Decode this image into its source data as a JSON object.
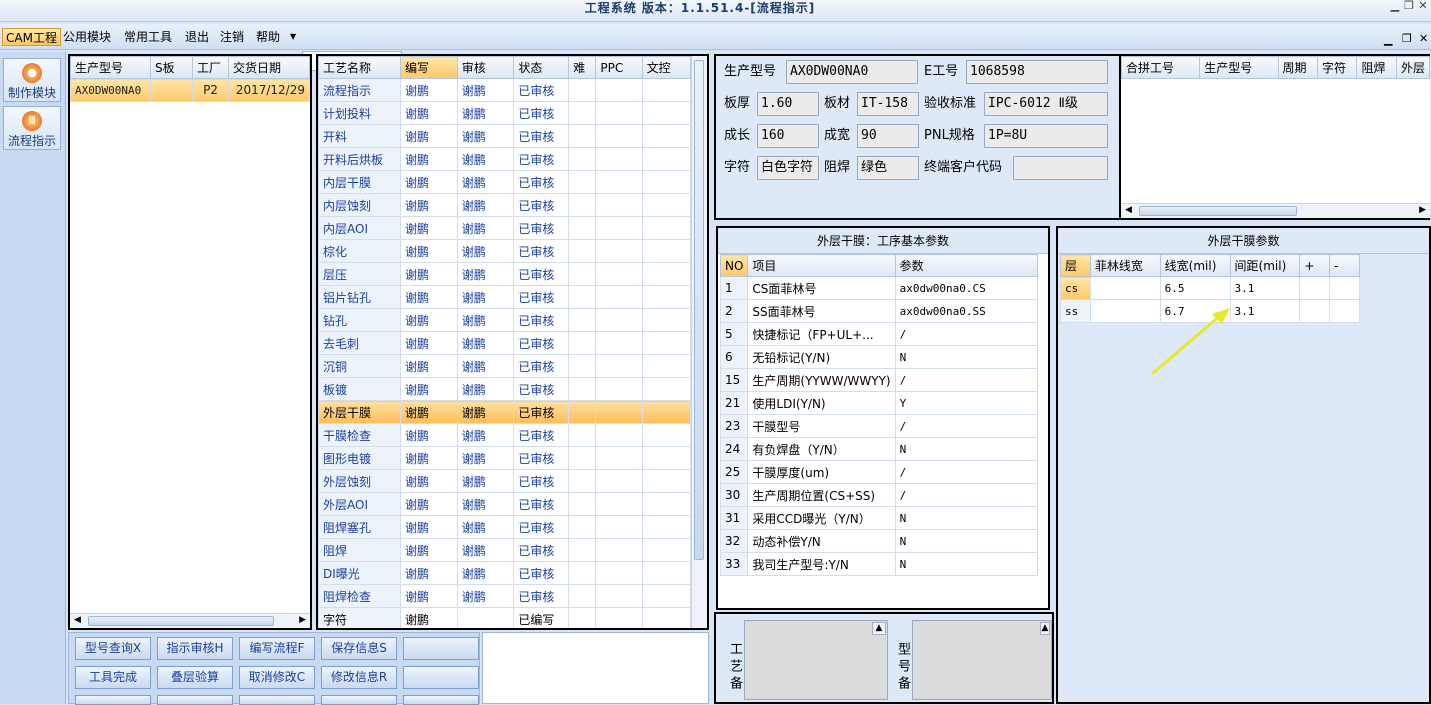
{
  "window": {
    "title": "工程系统 版本：1.1.51.4-[流程指示]"
  },
  "menubar": {
    "items": [
      "CAM工程",
      "公用模块",
      "常用工具",
      "退出",
      "注销",
      "帮助"
    ]
  },
  "toolbar": {
    "make_module": "制作模块",
    "flow_instruction": "流程指示"
  },
  "model_list": {
    "columns": [
      "生产型号",
      "S板",
      "工厂",
      "交货日期"
    ],
    "rows": [
      [
        "AX0DW00NA0",
        "",
        "P2",
        "2017/12/29"
      ]
    ]
  },
  "process_list": {
    "columns": [
      "工艺名称",
      "编写",
      "审核",
      "状态",
      "难",
      "PPC",
      "文控"
    ],
    "rows": [
      [
        "流程指示",
        "谢鹏",
        "谢鹏",
        "已审核"
      ],
      [
        "计划投料",
        "谢鹏",
        "谢鹏",
        "已审核"
      ],
      [
        "开料",
        "谢鹏",
        "谢鹏",
        "已审核"
      ],
      [
        "开料后烘板",
        "谢鹏",
        "谢鹏",
        "已审核"
      ],
      [
        "内层干膜",
        "谢鹏",
        "谢鹏",
        "已审核"
      ],
      [
        "内层蚀刻",
        "谢鹏",
        "谢鹏",
        "已审核"
      ],
      [
        "内层AOI",
        "谢鹏",
        "谢鹏",
        "已审核"
      ],
      [
        "棕化",
        "谢鹏",
        "谢鹏",
        "已审核"
      ],
      [
        "层压",
        "谢鹏",
        "谢鹏",
        "已审核"
      ],
      [
        "铝片钻孔",
        "谢鹏",
        "谢鹏",
        "已审核"
      ],
      [
        "钻孔",
        "谢鹏",
        "谢鹏",
        "已审核"
      ],
      [
        "去毛刺",
        "谢鹏",
        "谢鹏",
        "已审核"
      ],
      [
        "沉铜",
        "谢鹏",
        "谢鹏",
        "已审核"
      ],
      [
        "板镀",
        "谢鹏",
        "谢鹏",
        "已审核"
      ],
      [
        "外层干膜",
        "谢鹏",
        "谢鹏",
        "已审核"
      ],
      [
        "干膜检查",
        "谢鹏",
        "谢鹏",
        "已审核"
      ],
      [
        "图形电镀",
        "谢鹏",
        "谢鹏",
        "已审核"
      ],
      [
        "外层蚀刻",
        "谢鹏",
        "谢鹏",
        "已审核"
      ],
      [
        "外层AOI",
        "谢鹏",
        "谢鹏",
        "已审核"
      ],
      [
        "阻焊塞孔",
        "谢鹏",
        "谢鹏",
        "已审核"
      ],
      [
        "阻焊",
        "谢鹏",
        "谢鹏",
        "已审核"
      ],
      [
        "DI曝光",
        "谢鹏",
        "谢鹏",
        "已审核"
      ],
      [
        "阻焊检查",
        "谢鹏",
        "谢鹏",
        "已审核"
      ],
      [
        "字符",
        "谢鹏",
        "",
        "已编写"
      ]
    ],
    "selected_index": 14
  },
  "info": {
    "labels": {
      "model": "生产型号",
      "eno": "E工号",
      "thickness": "板厚",
      "material": "板材",
      "standard": "验收标准",
      "length": "成长",
      "width": "成宽",
      "pnl": "PNL规格",
      "char": "字符",
      "mask": "阻焊",
      "endcode": "终端客户代码"
    },
    "values": {
      "model": "AX0DW00NA0",
      "eno": "1068598",
      "thickness": "1.60",
      "material": "IT-158",
      "standard": "IPC-6012 Ⅱ级",
      "length": "160",
      "width": "90",
      "pnl": "1P=8U",
      "char": "白色字符",
      "mask": "绿色",
      "endcode": ""
    }
  },
  "combine_grid": {
    "columns": [
      "合拼工号",
      "生产型号",
      "周期",
      "字符",
      "阻焊",
      "外层"
    ]
  },
  "basic_params": {
    "title": "外层干膜：工序基本参数",
    "columns": [
      "NO",
      "项目",
      "参数"
    ],
    "rows": [
      [
        "1",
        "CS面菲林号",
        "ax0dw00na0.CS"
      ],
      [
        "2",
        "SS面菲林号",
        "ax0dw00na0.SS"
      ],
      [
        "5",
        "快捷标记（FP+UL+...",
        "/"
      ],
      [
        "6",
        "无铅标记(Y/N)",
        "N"
      ],
      [
        "15",
        "生产周期(YYWW/WWYY)",
        "/"
      ],
      [
        "21",
        "使用LDI(Y/N)",
        "Y"
      ],
      [
        "23",
        "干膜型号",
        "/"
      ],
      [
        "24",
        "有负焊盘（Y/N）",
        "N"
      ],
      [
        "25",
        "干膜厚度(um)",
        "/"
      ],
      [
        "30",
        "生产周期位置(CS+SS)",
        "/"
      ],
      [
        "31",
        "采用CCD曝光（Y/N）",
        "N"
      ],
      [
        "32",
        "动态补偿Y/N",
        "N"
      ],
      [
        "33",
        "我司生产型号:Y/N",
        "N"
      ]
    ]
  },
  "film_params": {
    "title": "外层干膜参数",
    "columns": [
      "层",
      "菲林线宽",
      "线宽(mil)",
      "间距(mil)",
      "+",
      "-"
    ],
    "rows": [
      [
        "cs",
        "",
        "6.5",
        "3.1",
        "",
        ""
      ],
      [
        "ss",
        "",
        "6.7",
        "3.1",
        "",
        ""
      ]
    ]
  },
  "buttons": {
    "row1": [
      "型号查询X",
      "指示审核H",
      "编写流程F",
      "保存信息S",
      ""
    ],
    "row2": [
      "工具完成",
      "叠层验算",
      "取消修改C",
      "修改信息R",
      ""
    ]
  },
  "notes": {
    "process_note": "工艺备",
    "model_note": "型号备"
  }
}
